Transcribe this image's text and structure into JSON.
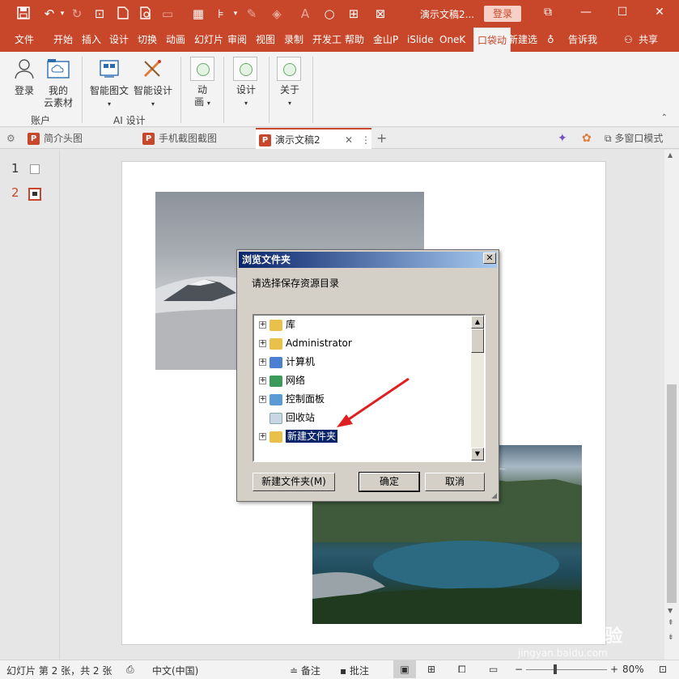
{
  "titlebar": {
    "title": "演示文稿2...",
    "login": "登录",
    "icons": [
      "save-icon",
      "undo-icon",
      "redo-icon",
      "present-icon",
      "new-doc-icon",
      "preview-icon",
      "image-icon",
      "grid-icon",
      "align-icon",
      "eyedropper-icon",
      "fill-icon",
      "font-color-icon",
      "circle-icon",
      "crop-icon",
      "close-doc-icon"
    ]
  },
  "menu": {
    "tabs": [
      "文件",
      "开始",
      "插入",
      "设计",
      "切换",
      "动画",
      "幻灯片",
      "审阅",
      "视图",
      "录制",
      "开发工",
      "帮助",
      "金山P",
      "iSlide",
      "OneK",
      "口袋动",
      "新建选"
    ],
    "active_tab": "口袋动",
    "tell_me": "告诉我",
    "share": "共享"
  },
  "ribbon": {
    "login": "登录",
    "my_assets_1": "我的",
    "my_assets_2": "云素材",
    "account_group": "账户",
    "smart_pic": "智能图文",
    "smart_design": "智能设计",
    "ai_group": "AI 设计",
    "anim_1": "动",
    "anim_2": "画",
    "design": "设计",
    "about": "关于"
  },
  "doc_tabs": {
    "tab1": "简介头图",
    "tab2": "手机截图截图",
    "tab3": "演示文稿2",
    "multi_window": "多窗口模式"
  },
  "thumbnails": {
    "n1": "1",
    "n2": "2"
  },
  "dialog": {
    "title": "浏览文件夹",
    "prompt": "请选择保存资源目录",
    "items": [
      {
        "label": "库",
        "expandable": true
      },
      {
        "label": "Administrator",
        "expandable": true
      },
      {
        "label": "计算机",
        "expandable": true
      },
      {
        "label": "网络",
        "expandable": true
      },
      {
        "label": "控制面板",
        "expandable": true
      },
      {
        "label": "回收站",
        "expandable": false
      },
      {
        "label": "新建文件夹",
        "expandable": true,
        "selected": true
      }
    ],
    "new_folder": "新建文件夹(M)",
    "ok": "确定",
    "cancel": "取消"
  },
  "status": {
    "slide_info": "幻灯片 第 2 张，共 2 张",
    "language": "中文(中国)",
    "notes": "备注",
    "comments": "批注",
    "zoom": "80%"
  },
  "watermark": {
    "brand": "Baidu 经验",
    "url": "jingyan.baidu.com"
  },
  "colors": {
    "accent": "#c8472a",
    "dialog_title": "#0a246a",
    "selection": "#0a246a",
    "annotation_arrow": "#e02020"
  }
}
